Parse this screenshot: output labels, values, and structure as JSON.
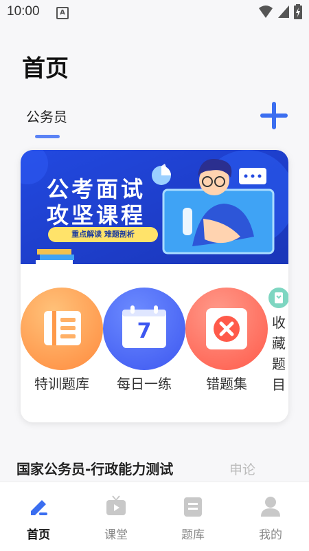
{
  "status": {
    "time": "10:00",
    "a_badge": "A"
  },
  "header": {
    "title": "首页"
  },
  "tabs": [
    {
      "label": "公务员",
      "active": true
    }
  ],
  "banner": {
    "line1": "公考面试",
    "line2": "攻坚课程",
    "subtitle": "重点解读 难题剖析"
  },
  "features": [
    {
      "label": "特训题库",
      "icon": "question-bank-icon"
    },
    {
      "label": "每日一练",
      "icon": "calendar-icon",
      "icon_text": "7"
    },
    {
      "label": "错题集",
      "icon": "wrong-icon"
    }
  ],
  "favorites": {
    "label": "收藏题目",
    "chars": [
      "收",
      "藏",
      "题",
      "目"
    ]
  },
  "section": {
    "title": "国家公务员-行政能力测试",
    "tab2": "申论"
  },
  "nav": [
    {
      "label": "首页",
      "icon": "pen-icon",
      "active": true
    },
    {
      "label": "课堂",
      "icon": "tv-icon",
      "active": false
    },
    {
      "label": "题库",
      "icon": "book-icon",
      "active": false
    },
    {
      "label": "我的",
      "icon": "user-icon",
      "active": false
    }
  ],
  "colors": {
    "accent": "#3b6ef0",
    "tab_underline": "#5b83f5",
    "banner_bg": "#1d3fd6"
  }
}
